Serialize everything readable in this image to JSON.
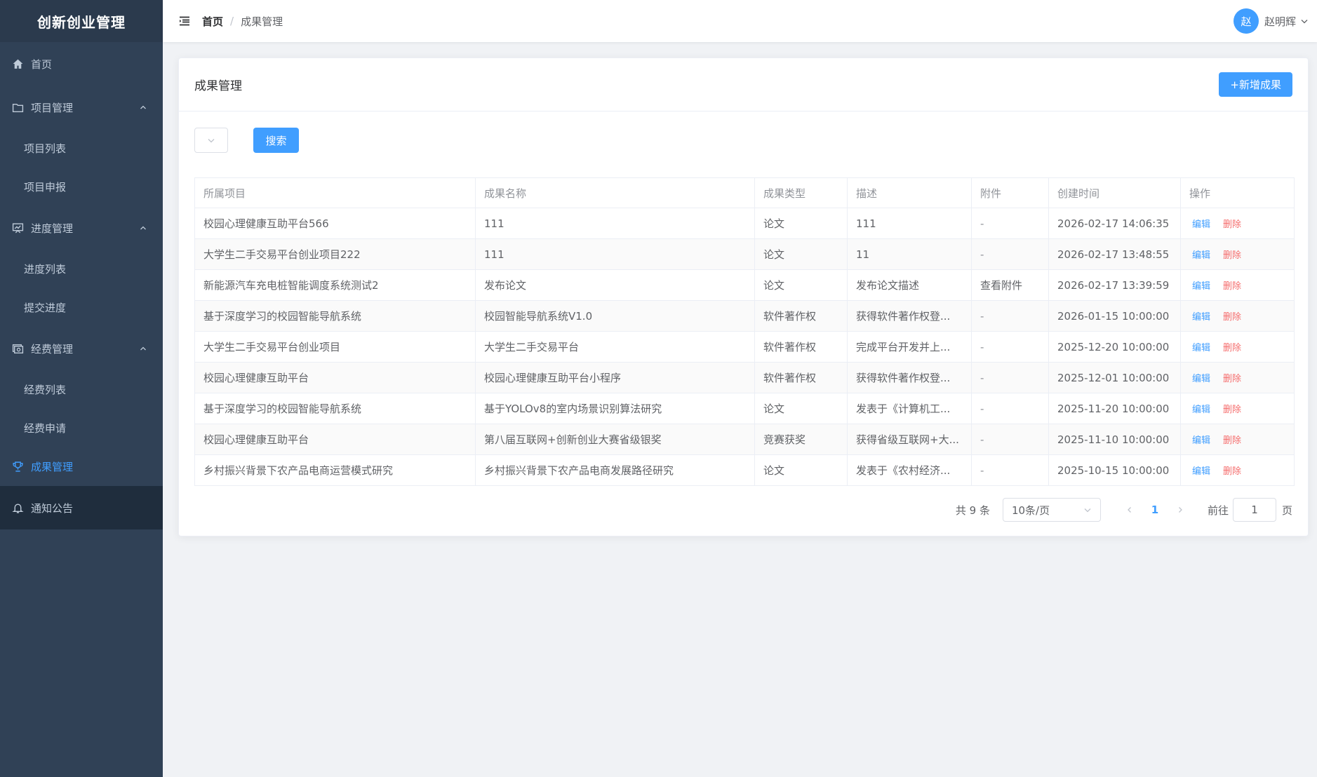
{
  "app": {
    "title": "创新创业管理"
  },
  "colors": {
    "primary": "#409eff",
    "danger": "#f56c6c",
    "sidebar_bg": "#304156"
  },
  "sidebar": {
    "home": "首页",
    "project": {
      "label": "项目管理",
      "items": [
        "项目列表",
        "项目申报"
      ]
    },
    "progress": {
      "label": "进度管理",
      "items": [
        "进度列表",
        "提交进度"
      ]
    },
    "funds": {
      "label": "经费管理",
      "items": [
        "经费列表",
        "经费申请"
      ]
    },
    "achievements": "成果管理",
    "notice": "通知公告"
  },
  "header": {
    "breadcrumb_home": "首页",
    "breadcrumb_sep": "/",
    "breadcrumb_current": "成果管理",
    "avatar_text": "赵",
    "username": "赵明辉"
  },
  "card": {
    "title": "成果管理",
    "add_button": "+新增成果",
    "search_button": "搜索"
  },
  "table": {
    "columns": [
      "所属项目",
      "成果名称",
      "成果类型",
      "描述",
      "附件",
      "创建时间",
      "操作"
    ],
    "edit_label": "编辑",
    "delete_label": "删除",
    "rows": [
      [
        "校园心理健康互助平台566",
        "111",
        "论文",
        "111",
        "-",
        "2026-02-17 14:06:35"
      ],
      [
        "大学生二手交易平台创业项目222",
        "111",
        "论文",
        "11",
        "-",
        "2026-02-17 13:48:55"
      ],
      [
        "新能源汽车充电桩智能调度系统测试2",
        "发布论文",
        "论文",
        "发布论文描述",
        "查看附件",
        "2026-02-17 13:39:59"
      ],
      [
        "基于深度学习的校园智能导航系统",
        "校园智能导航系统V1.0",
        "软件著作权",
        "获得软件著作权登...",
        "-",
        "2026-01-15 10:00:00"
      ],
      [
        "大学生二手交易平台创业项目",
        "大学生二手交易平台",
        "软件著作权",
        "完成平台开发并上...",
        "-",
        "2025-12-20 10:00:00"
      ],
      [
        "校园心理健康互助平台",
        "校园心理健康互助平台小程序",
        "软件著作权",
        "获得软件著作权登...",
        "-",
        "2025-12-01 10:00:00"
      ],
      [
        "基于深度学习的校园智能导航系统",
        "基于YOLOv8的室内场景识别算法研究",
        "论文",
        "发表于《计算机工...",
        "-",
        "2025-11-20 10:00:00"
      ],
      [
        "校园心理健康互助平台",
        "第八届互联网+创新创业大赛省级银奖",
        "竞赛获奖",
        "获得省级互联网+大...",
        "-",
        "2025-11-10 10:00:00"
      ],
      [
        "乡村振兴背景下农产品电商运营模式研究",
        "乡村振兴背景下农产品电商发展路径研究",
        "论文",
        "发表于《农村经济...",
        "-",
        "2025-10-15 10:00:00"
      ]
    ]
  },
  "pagination": {
    "total": "共 9 条",
    "page_size": "10条/页",
    "current_page": "1",
    "goto_label": "前往",
    "goto_value": "1",
    "page_suffix": "页"
  }
}
